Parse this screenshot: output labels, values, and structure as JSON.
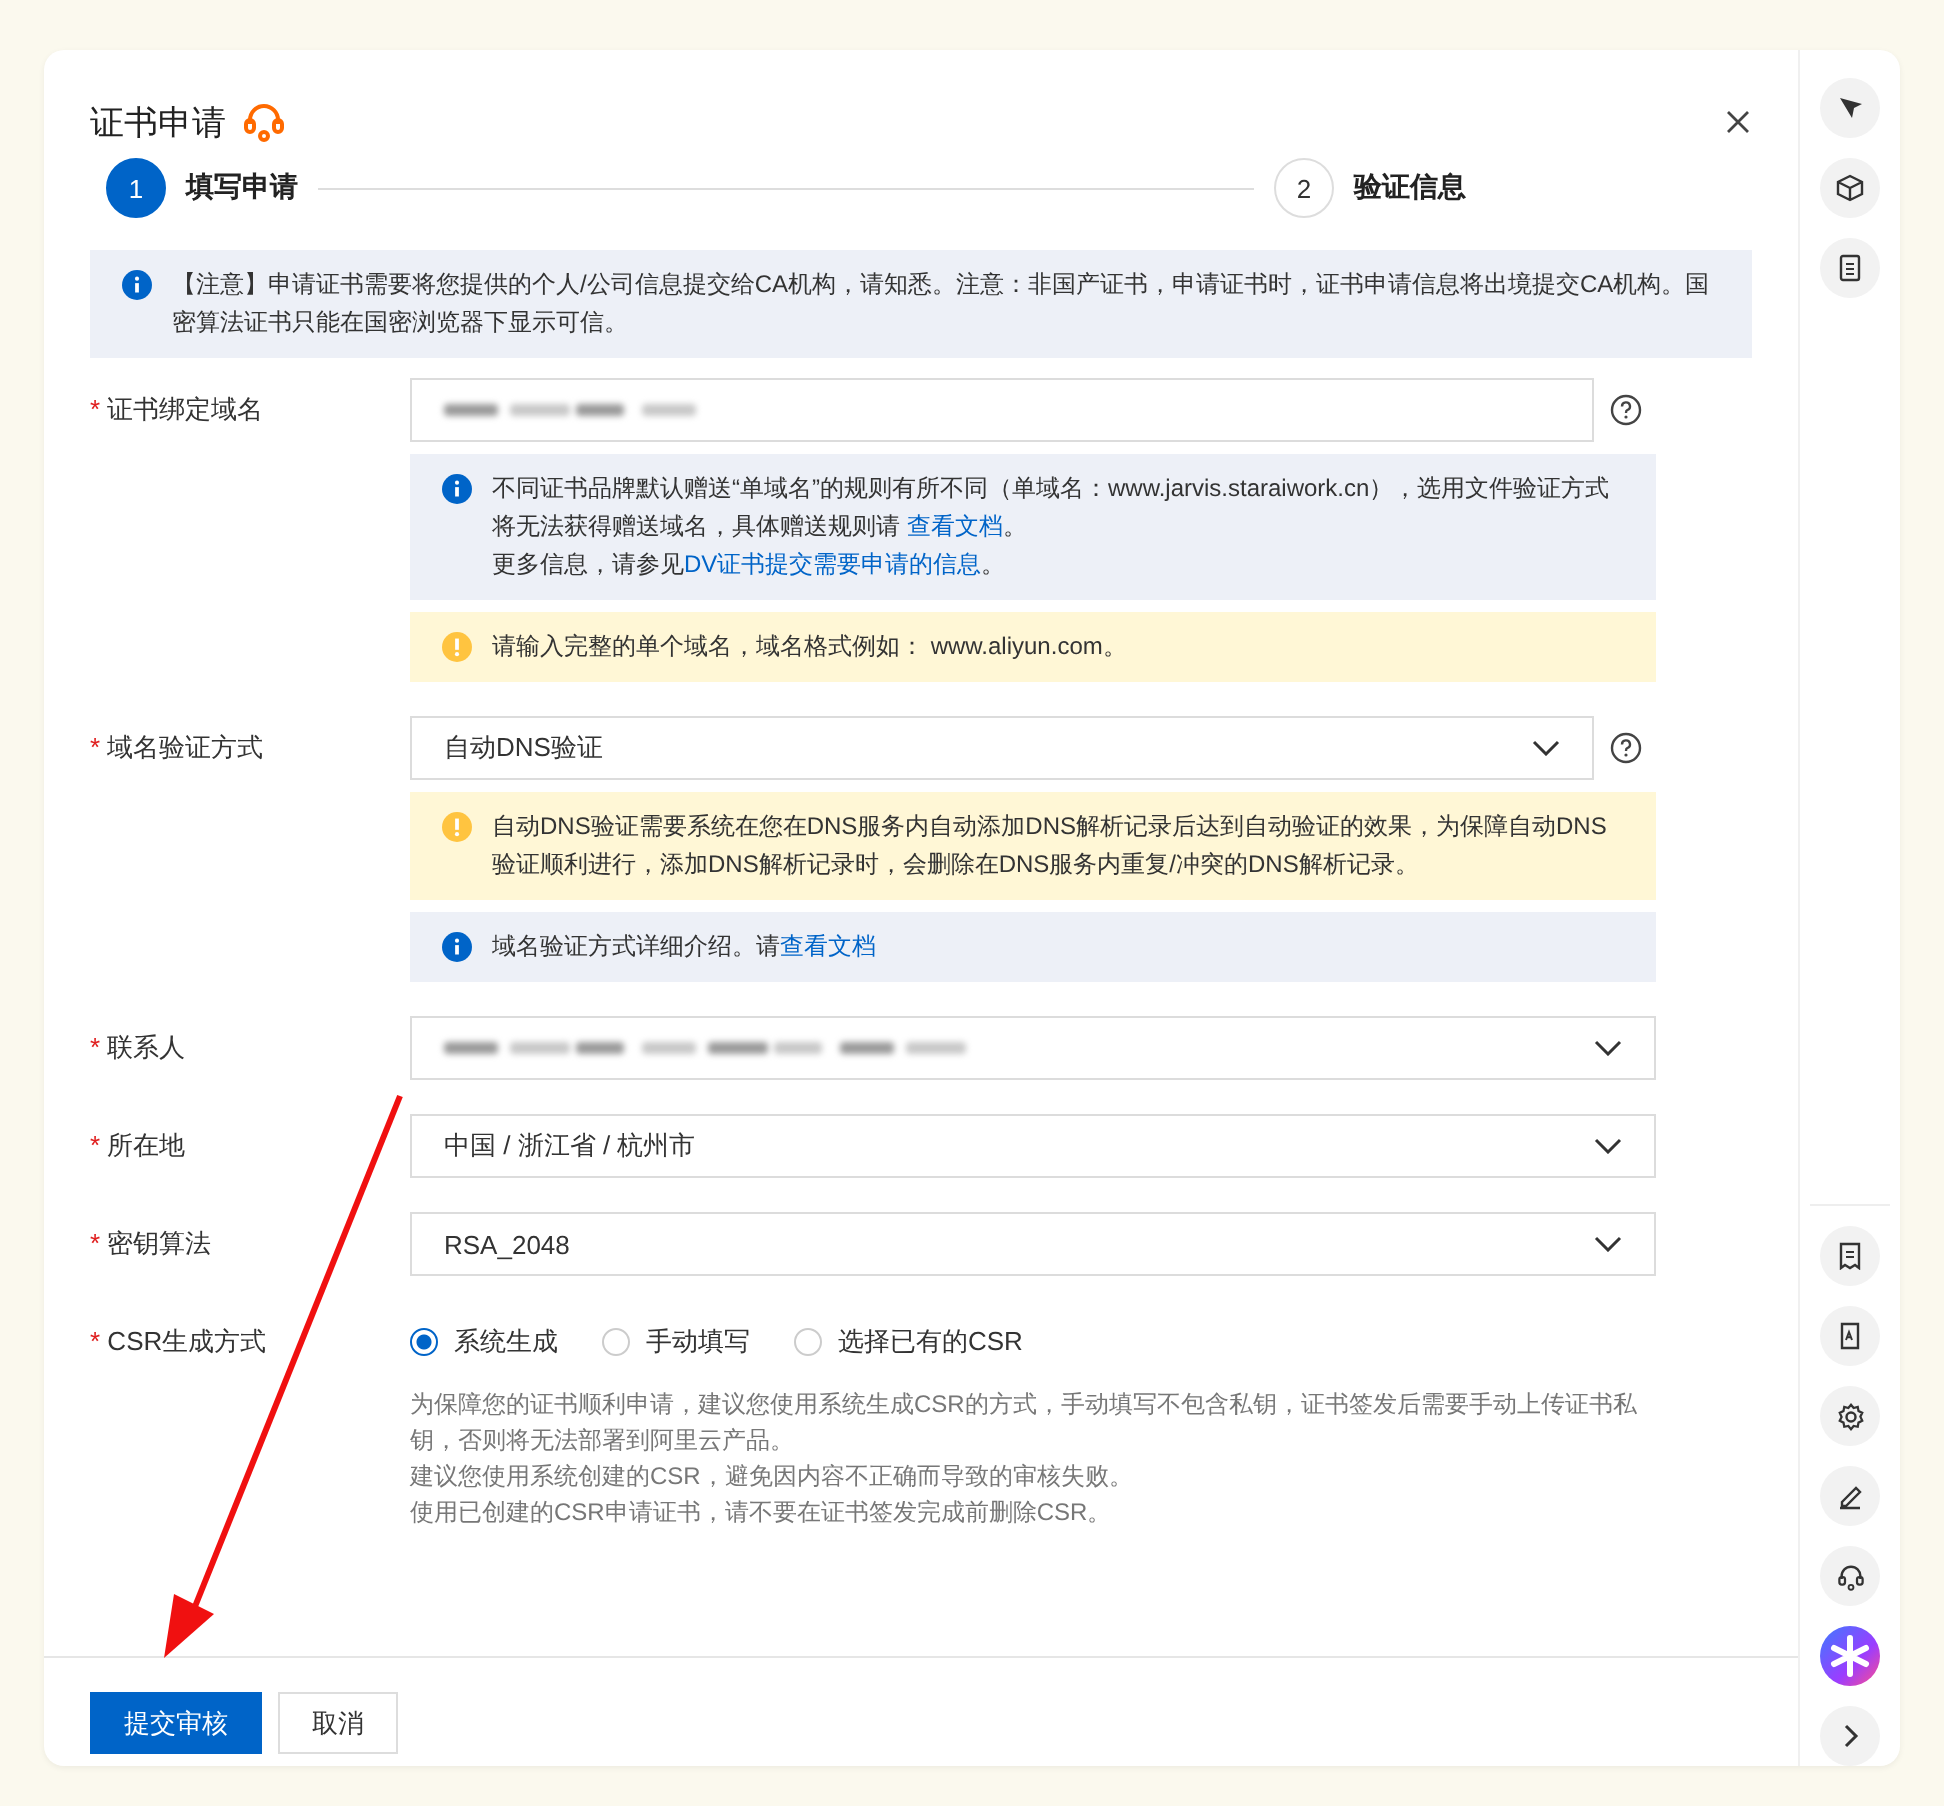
{
  "dialog": {
    "title": "证书申请"
  },
  "steps": [
    {
      "number": "1",
      "label": "填写申请",
      "selected": true
    },
    {
      "number": "2",
      "label": "验证信息",
      "selected": false
    }
  ],
  "notice": {
    "text": "【注意】申请证书需要将您提供的个人/公司信息提交给CA机构，请知悉。注意：非国产证书，申请证书时，证书申请信息将出境提交CA机构。国密算法证书只能在国密浏览器下显示可信。"
  },
  "fields": [
    {
      "kind": "input",
      "mark": "*",
      "label": "证书绑定域名",
      "value_hidden": true,
      "help": true,
      "notes": [
        {
          "kind": "info",
          "paragraphs": [
            [
              {
                "text": "不同证书品牌默认赠送“单域名”的规则有所不同（单域名：www.jarvis.staraiwork.cn），选用文件验证方式将无法获得赠送域名，具体赠送规则请 "
              },
              {
                "text": "查看文档",
                "link": true
              },
              {
                "text": "。"
              }
            ],
            [
              {
                "text": "更多信息，请参见"
              },
              {
                "text": "DV证书提交需要申请的信息",
                "link": true
              },
              {
                "text": "。"
              }
            ]
          ]
        },
        {
          "kind": "warning",
          "paragraphs": [
            [
              {
                "text": "请输入完整的单个域名，域名格式例如： www.aliyun.com。"
              }
            ]
          ]
        }
      ]
    },
    {
      "kind": "select",
      "mark": "*",
      "label": "域名验证方式",
      "value": "自动DNS验证",
      "help": true,
      "notes": [
        {
          "kind": "warning",
          "paragraphs": [
            [
              {
                "text": "自动DNS验证需要系统在您在DNS服务内自动添加DNS解析记录后达到自动验证的效果，为保障自动DNS验证顺利进行，添加DNS解析记录时，会删除在DNS服务内重复/冲突的DNS解析记录。"
              }
            ]
          ]
        },
        {
          "kind": "info",
          "paragraphs": [
            [
              {
                "text": "域名验证方式详细介绍。请"
              },
              {
                "text": "查看文档",
                "link": true
              }
            ]
          ]
        }
      ]
    },
    {
      "kind": "select",
      "mark": "*",
      "label": "联系人",
      "value_hidden": true
    },
    {
      "kind": "select",
      "mark": "*",
      "label": "所在地",
      "value": "中国 / 浙江省 / 杭州市"
    },
    {
      "kind": "select",
      "mark": "*",
      "label": "密钥算法",
      "value": "RSA_2048"
    },
    {
      "kind": "radio",
      "mark": "*",
      "label": "CSR生成方式",
      "options": [
        {
          "label": "系统生成",
          "selected": true
        },
        {
          "label": "手动填写",
          "selected": false
        },
        {
          "label": "选择已有的CSR",
          "selected": false
        }
      ],
      "description": [
        "为保障您的证书顺利申请，建议您使用系统生成CSR的方式，手动填写不包含私钥，证书签发后需要手动上传证书私钥，否则将无法部署到阿里云产品。",
        "建议您使用系统创建的CSR，避免因内容不正确而导致的审核失败。",
        "使用已创建的CSR申请证书，请不要在证书签发完成前删除CSR。"
      ]
    }
  ],
  "footer": {
    "buttons": [
      {
        "label": "提交审核",
        "kind": "primary"
      },
      {
        "label": "取消",
        "kind": "default"
      }
    ]
  }
}
